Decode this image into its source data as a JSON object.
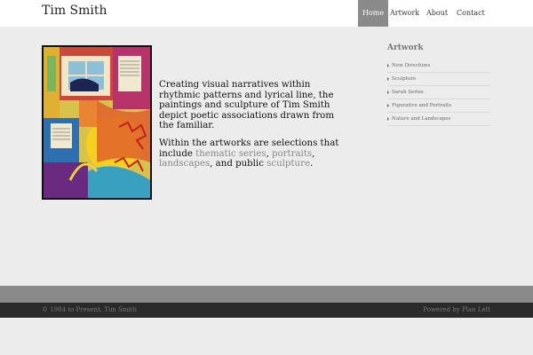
{
  "header": {
    "site_title": "Tim Smith",
    "nav": [
      {
        "label": "Home",
        "active": true
      },
      {
        "label": "Artwork"
      },
      {
        "label": "About"
      },
      {
        "label": "Contact"
      }
    ]
  },
  "main": {
    "intro": "Creating visual narratives within rhythmic patterns and lyrical line, the paintings and sculpture of Tim Smith depict poetic associations drawn from the familiar.",
    "selections": {
      "prefix": "Within the artworks are selections that include ",
      "link1": "thematic series",
      "sep1": ", ",
      "link2": "portraits",
      "sep2": ", ",
      "link3": "landscapes",
      "sep3": ", and public ",
      "link4": "sculpture",
      "suffix": "."
    }
  },
  "sidebar": {
    "title": "Artwork",
    "items": [
      {
        "label": "New Directions"
      },
      {
        "label": "Sculpture"
      },
      {
        "label": "Sarah Series"
      },
      {
        "label": "Figurative and Portraits"
      },
      {
        "label": "Nature and Landscapes"
      }
    ]
  },
  "footer": {
    "copyright": "© 1984 to Present, Tim Smith",
    "powered_prefix": "Powered by ",
    "powered_link": "Plan Left"
  },
  "colors": {
    "active_nav": "#8a8a8a",
    "link": "#888888",
    "footer_band": "#8a8a8a",
    "footer": "#2a2a2a"
  }
}
